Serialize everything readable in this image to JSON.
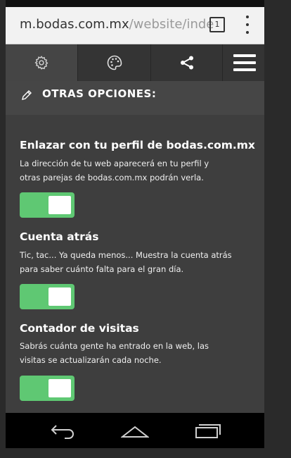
{
  "browser": {
    "url_host": "m.bodas.com.mx",
    "url_path": "/website/inde",
    "tab_count": "1"
  },
  "toolbar": {
    "tools": [
      {
        "icon": "gear-icon"
      },
      {
        "icon": "palette-icon"
      },
      {
        "icon": "share-icon"
      },
      {
        "icon": "hamburger-menu-icon"
      }
    ]
  },
  "section": {
    "title": "OTRAS OPCIONES:",
    "icon": "pencil-icon"
  },
  "options": [
    {
      "title": "Enlazar con tu perfil de bodas.com.mx",
      "desc_line1": "La dirección de tu web aparecerá en tu perfil y",
      "desc_line2": "otras parejas de bodas.com.mx podrán verla.",
      "enabled": true
    },
    {
      "title": "Cuenta atrás",
      "desc_line1": "Tic, tac... Ya queda menos... Muestra la cuenta atrás",
      "desc_line2": "para saber cuánto falta para el gran día.",
      "enabled": true
    },
    {
      "title": "Contador de visitas",
      "desc_line1": "Sabrás cuánta gente ha entrado en la web, las",
      "desc_line2": "visitas se actualizarán cada noche.",
      "enabled": true
    }
  ],
  "colors": {
    "toggle_on": "#5fc873",
    "panel_bg": "#3e3e3e",
    "header_bg": "#464646"
  },
  "navbar": {
    "buttons": [
      "back-icon",
      "home-icon",
      "recents-icon"
    ]
  }
}
